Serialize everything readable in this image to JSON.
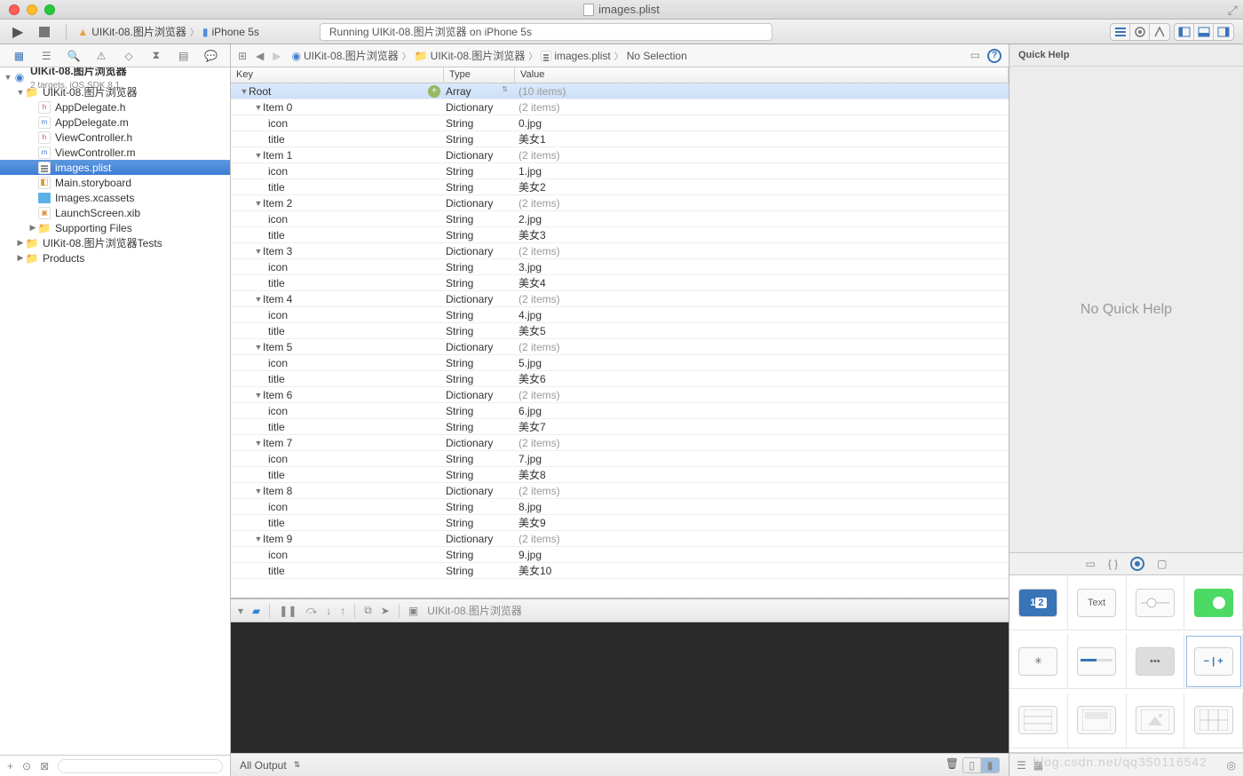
{
  "window": {
    "title": "images.plist"
  },
  "toolbar": {
    "scheme_app": "UIKit-08.图片浏览器",
    "scheme_device": "iPhone 5s",
    "activity": "Running UIKit-08.图片浏览器 on iPhone 5s"
  },
  "navigator": {
    "project": "UIKit-08.图片浏览器",
    "project_sub": "2 targets, iOS SDK 8.1",
    "main_group": "UIKit-08.图片浏览器",
    "files": {
      "appdelegate_h": "AppDelegate.h",
      "appdelegate_m": "AppDelegate.m",
      "viewcontroller_h": "ViewController.h",
      "viewcontroller_m": "ViewController.m",
      "images_plist": "images.plist",
      "main_storyboard": "Main.storyboard",
      "images_xcassets": "Images.xcassets",
      "launchscreen_xib": "LaunchScreen.xib"
    },
    "supporting": "Supporting Files",
    "tests": "UIKit-08.图片浏览器Tests",
    "products": "Products"
  },
  "jumpbar": {
    "c1": "UIKit-08.图片浏览器",
    "c2": "UIKit-08.图片浏览器",
    "c3": "images.plist",
    "c4": "No Selection"
  },
  "plist_headers": {
    "key": "Key",
    "type": "Type",
    "value": "Value"
  },
  "plist": {
    "root": {
      "key": "Root",
      "type": "Array",
      "value": "(10 items)"
    },
    "items": [
      {
        "key": "Item 0",
        "type": "Dictionary",
        "value": "(2 items)",
        "children": [
          {
            "key": "icon",
            "type": "String",
            "value": "0.jpg"
          },
          {
            "key": "title",
            "type": "String",
            "value": "美女1"
          }
        ]
      },
      {
        "key": "Item 1",
        "type": "Dictionary",
        "value": "(2 items)",
        "children": [
          {
            "key": "icon",
            "type": "String",
            "value": "1.jpg"
          },
          {
            "key": "title",
            "type": "String",
            "value": "美女2"
          }
        ]
      },
      {
        "key": "Item 2",
        "type": "Dictionary",
        "value": "(2 items)",
        "children": [
          {
            "key": "icon",
            "type": "String",
            "value": "2.jpg"
          },
          {
            "key": "title",
            "type": "String",
            "value": "美女3"
          }
        ]
      },
      {
        "key": "Item 3",
        "type": "Dictionary",
        "value": "(2 items)",
        "children": [
          {
            "key": "icon",
            "type": "String",
            "value": "3.jpg"
          },
          {
            "key": "title",
            "type": "String",
            "value": "美女4"
          }
        ]
      },
      {
        "key": "Item 4",
        "type": "Dictionary",
        "value": "(2 items)",
        "children": [
          {
            "key": "icon",
            "type": "String",
            "value": "4.jpg"
          },
          {
            "key": "title",
            "type": "String",
            "value": "美女5"
          }
        ]
      },
      {
        "key": "Item 5",
        "type": "Dictionary",
        "value": "(2 items)",
        "children": [
          {
            "key": "icon",
            "type": "String",
            "value": "5.jpg"
          },
          {
            "key": "title",
            "type": "String",
            "value": "美女6"
          }
        ]
      },
      {
        "key": "Item 6",
        "type": "Dictionary",
        "value": "(2 items)",
        "children": [
          {
            "key": "icon",
            "type": "String",
            "value": "6.jpg"
          },
          {
            "key": "title",
            "type": "String",
            "value": "美女7"
          }
        ]
      },
      {
        "key": "Item 7",
        "type": "Dictionary",
        "value": "(2 items)",
        "children": [
          {
            "key": "icon",
            "type": "String",
            "value": "7.jpg"
          },
          {
            "key": "title",
            "type": "String",
            "value": "美女8"
          }
        ]
      },
      {
        "key": "Item 8",
        "type": "Dictionary",
        "value": "(2 items)",
        "children": [
          {
            "key": "icon",
            "type": "String",
            "value": "8.jpg"
          },
          {
            "key": "title",
            "type": "String",
            "value": "美女9"
          }
        ]
      },
      {
        "key": "Item 9",
        "type": "Dictionary",
        "value": "(2 items)",
        "children": [
          {
            "key": "icon",
            "type": "String",
            "value": "9.jpg"
          },
          {
            "key": "title",
            "type": "String",
            "value": "美女10"
          }
        ]
      }
    ]
  },
  "debug": {
    "target": "UIKit-08.图片浏览器",
    "output": "All Output"
  },
  "inspector": {
    "header": "Quick Help",
    "body": "No Quick Help"
  },
  "library": {
    "items": [
      "Segmented",
      "Text",
      "Slider",
      "Switch",
      "Activity",
      "Progress",
      "PageControl",
      "Stepper",
      "TableView",
      "TableCell",
      "ImageView",
      "CollectionView"
    ]
  },
  "watermark": "blog.csdn.net/qq350116542"
}
